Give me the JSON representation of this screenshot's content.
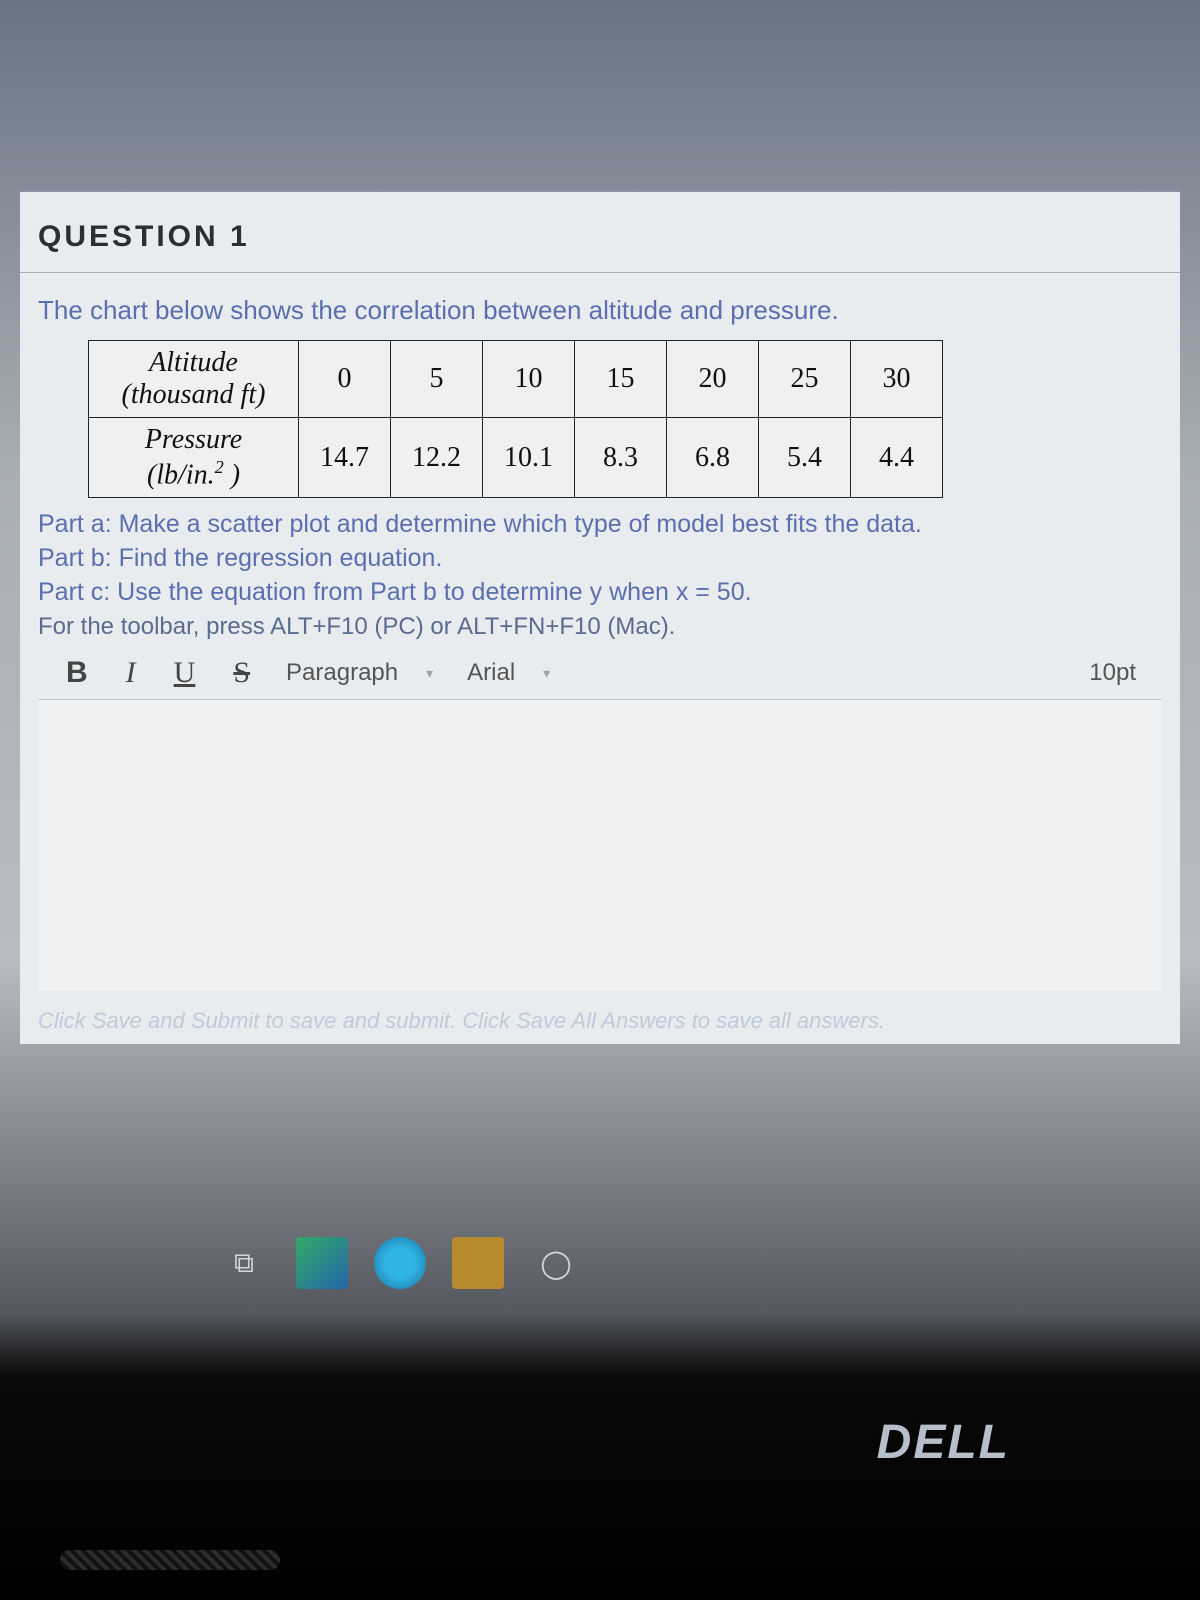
{
  "question": {
    "heading": "QUESTION 1",
    "prompt": "The chart below shows the correlation between altitude and pressure.",
    "table": {
      "row1_label_line1": "Altitude",
      "row1_label_line2": "(thousand ft)",
      "row2_label_line1": "Pressure",
      "row2_label_line2": "(lb/in.",
      "row2_label_sup": "2",
      "row2_label_close": " )",
      "altitude": [
        "0",
        "5",
        "10",
        "15",
        "20",
        "25",
        "30"
      ],
      "pressure": [
        "14.7",
        "12.2",
        "10.1",
        "8.3",
        "6.8",
        "5.4",
        "4.4"
      ]
    },
    "part_a": "Part a: Make a scatter plot and determine which type of model best fits the data.",
    "part_b": "Part b: Find the regression equation.",
    "part_c": "Part c: Use the equation from Part b to determine y when x = 50.",
    "toolbar_hint": "For the toolbar, press ALT+F10 (PC) or ALT+FN+F10 (Mac)."
  },
  "toolbar": {
    "bold": "B",
    "italic": "I",
    "underline": "U",
    "strike": "S",
    "block_format": "Paragraph",
    "font_family": "Arial",
    "font_size": "10pt"
  },
  "footer": {
    "save_hint": "Click Save and Submit to save and submit. Click Save All Answers to save all answers."
  },
  "laptop": {
    "brand": "DELL"
  },
  "chart_data": {
    "type": "table",
    "title": "Correlation between altitude and pressure",
    "columns": [
      "Altitude (thousand ft)",
      "Pressure (lb/in.^2)"
    ],
    "rows": [
      [
        0,
        14.7
      ],
      [
        5,
        12.2
      ],
      [
        10,
        10.1
      ],
      [
        15,
        8.3
      ],
      [
        20,
        6.8
      ],
      [
        25,
        5.4
      ],
      [
        30,
        4.4
      ]
    ]
  }
}
